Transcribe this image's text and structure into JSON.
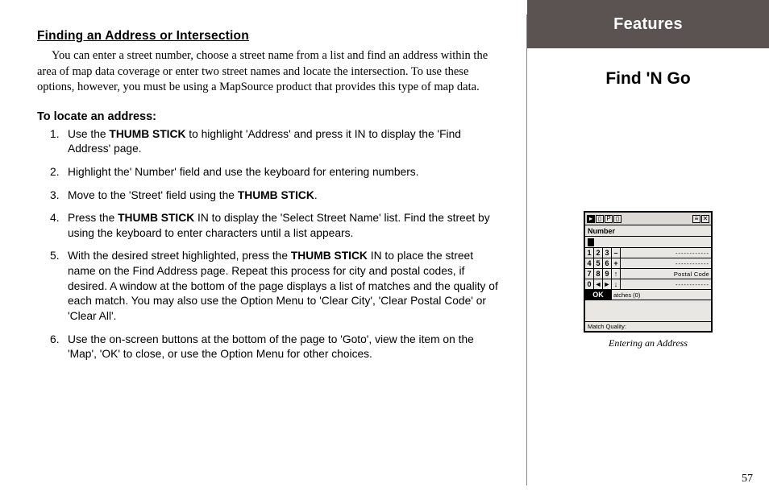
{
  "heading": "Finding an Address or Intersection",
  "intro": "You can enter a street number, choose a street name from a list and find an address within the area of map data coverage or enter two street names and locate the intersection.  To use these options, however, you must be using a MapSource product that provides this type of map data.",
  "subheading": "To locate an address:",
  "steps": [
    {
      "pre": "Use the ",
      "bold": "THUMB STICK",
      "post": " to highlight 'Address' and press it IN to display the 'Find Address' page."
    },
    {
      "pre": "Highlight the' Number' field and use the keyboard for entering numbers.",
      "bold": "",
      "post": ""
    },
    {
      "pre": "Move to the 'Street' field using the ",
      "bold": "THUMB STICK",
      "post": "."
    },
    {
      "pre": "Press the ",
      "bold": "THUMB STICK",
      "post": " IN to display the 'Select Street Name' list.  Find the street by using the keyboard to enter characters until a list appears."
    },
    {
      "pre": "With the desired street highlighted, press the ",
      "bold": "THUMB STICK",
      "post": " IN to place the street name on the Find Address page.  Repeat this process for city and postal codes, if desired.  A window at the bottom of the page displays a list of matches and the quality of each match.  You may also use the Option Menu to 'Clear City', 'Clear Postal Code' or 'Clear All'."
    },
    {
      "pre": "Use the on-screen buttons at the bottom of the page to 'Goto', view the item on the 'Map', 'OK' to close, or use the Option Menu for other choices.",
      "bold": "",
      "post": ""
    }
  ],
  "banner": "Features",
  "topic": "Find 'N Go",
  "device": {
    "number_label": "Number",
    "keypad": [
      [
        "1",
        "2",
        "3",
        "–"
      ],
      [
        "4",
        "5",
        "6",
        "+"
      ],
      [
        "7",
        "8",
        "9",
        "↑"
      ],
      [
        "0",
        "◄",
        "►",
        "↓"
      ]
    ],
    "side_labels": [
      "",
      "",
      "Postal Code",
      ""
    ],
    "ok": "OK",
    "matches": "atches (0)",
    "quality": "Match Quality:"
  },
  "caption": "Entering an Address",
  "page_number": "57"
}
